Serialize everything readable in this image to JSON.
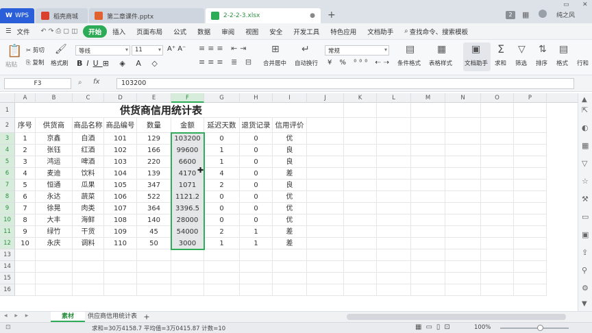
{
  "titlebar": {
    "tabs": [
      {
        "label": "WPS",
        "color": "#2b5fd9"
      },
      {
        "label": "稻壳商城",
        "color": "#d9412e"
      },
      {
        "label": "第二章课件.pptx",
        "color": "#e0622f"
      },
      {
        "label": "2-2-2-3.xlsx",
        "color": "#2eab56"
      }
    ],
    "new_tab": "+",
    "page_count": "2",
    "user": "纯之风"
  },
  "menubar": {
    "file_label": "文件",
    "items": [
      "开始",
      "插入",
      "页面布局",
      "公式",
      "数据",
      "审阅",
      "视图",
      "安全",
      "开发工具",
      "特色应用",
      "文档助手"
    ],
    "active_index": 0,
    "search_label": "查找命令、搜索模板"
  },
  "ribbon": {
    "cut": "剪切",
    "copy": "复制",
    "format_painter": "格式刷",
    "paste": "粘贴",
    "font_name": "等线",
    "font_size": "11",
    "merge_center": "合并居中",
    "wrap_text": "自动换行",
    "number_format": "常规",
    "conditional_format": "条件格式",
    "table_style": "表格样式",
    "doc_helper": "文档助手",
    "sum": "求和",
    "filter": "筛选",
    "sort": "排序",
    "format": "格式",
    "row_col": "行和"
  },
  "formula_bar": {
    "name_box": "F3",
    "fx": "fx",
    "value": "103200"
  },
  "sheet": {
    "columns": [
      "A",
      "B",
      "C",
      "D",
      "E",
      "F",
      "G",
      "H",
      "I",
      "J",
      "K",
      "L",
      "M",
      "N",
      "O",
      "P"
    ],
    "rows": [
      "1",
      "2",
      "3",
      "4",
      "5",
      "6",
      "7",
      "8",
      "9",
      "10",
      "11",
      "12",
      "13",
      "14",
      "15",
      "16"
    ],
    "selected_column": "F",
    "title": "供货商信用统计表",
    "headers": [
      "序号",
      "供货商",
      "商品名称",
      "商品编号",
      "数量",
      "金额",
      "延迟天数",
      "退货记录",
      "信用评价"
    ],
    "data": [
      [
        "1",
        "京鑫",
        "白酒",
        "101",
        "129",
        "103200",
        "0",
        "0",
        "优"
      ],
      [
        "2",
        "张钰",
        "红酒",
        "102",
        "166",
        "99600",
        "1",
        "0",
        "良"
      ],
      [
        "3",
        "鸿运",
        "啤酒",
        "103",
        "220",
        "6600",
        "1",
        "0",
        "良"
      ],
      [
        "4",
        "麦迪",
        "饮料",
        "104",
        "139",
        "4170",
        "4",
        "0",
        "差"
      ],
      [
        "5",
        "恒通",
        "瓜果",
        "105",
        "347",
        "1071",
        "2",
        "0",
        "良"
      ],
      [
        "6",
        "永达",
        "蔬菜",
        "106",
        "522",
        "1121.2",
        "0",
        "0",
        "优"
      ],
      [
        "7",
        "徐晃",
        "肉类",
        "107",
        "364",
        "3396.5",
        "0",
        "0",
        "优"
      ],
      [
        "8",
        "大丰",
        "海鲜",
        "108",
        "140",
        "28000",
        "0",
        "0",
        "优"
      ],
      [
        "9",
        "绿竹",
        "干货",
        "109",
        "45",
        "54000",
        "2",
        "1",
        "差"
      ],
      [
        "10",
        "永庆",
        "调料",
        "110",
        "50",
        "3000",
        "1",
        "1",
        "差"
      ]
    ]
  },
  "sheet_tabs": {
    "tabs": [
      "素材",
      "供应商信用统计表"
    ],
    "active_index": 0,
    "add": "+"
  },
  "statusbar": {
    "summary": "求和=30万4158.7  平均值=3万0415.87  计数=10",
    "zoom": "100%"
  },
  "colors": {
    "accent": "#2eab56",
    "wps_blue": "#2b5fd9"
  }
}
